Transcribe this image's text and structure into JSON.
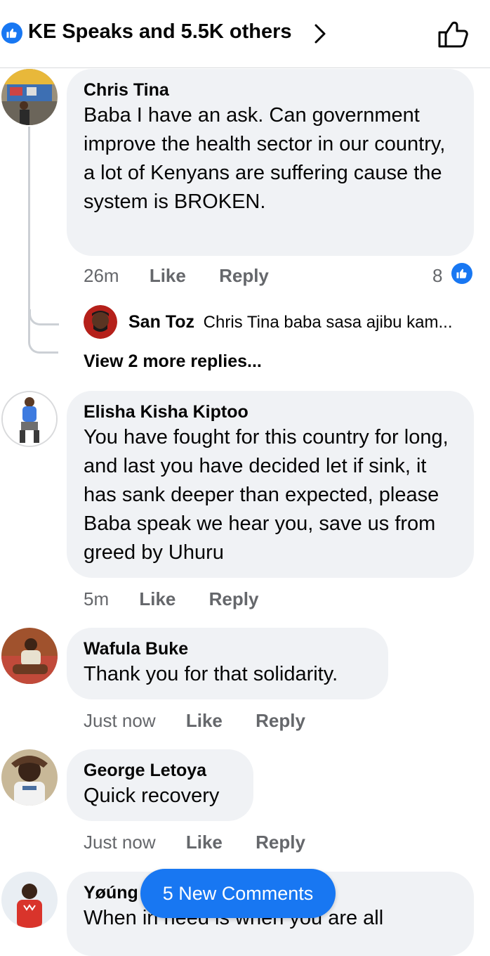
{
  "header": {
    "reactions_text": "KE Speaks and 5.5K others",
    "icons": [
      "like-badge-icon",
      "chevron-right-icon",
      "thumbs-up-outline-icon"
    ]
  },
  "comments": [
    {
      "author": "Chris Tina",
      "text": "Baba I have an ask. Can government improve the health sector in our country, a lot of Kenyans are suffering cause the system is BROKEN.",
      "time": "26m",
      "like_label": "Like",
      "reply_label": "Reply",
      "like_count": "8",
      "reply": {
        "author": "San Toz",
        "text": "Chris Tina baba sasa ajibu kam..."
      },
      "view_more": "View 2 more replies..."
    },
    {
      "author": "Elisha Kisha Kiptoo",
      "text": "You have fought for this country for long, and last you have decided let if sink, it has sank deeper than expected, please Baba speak we hear you, save us from greed by Uhuru",
      "time": "5m",
      "like_label": "Like",
      "reply_label": "Reply"
    },
    {
      "author": "Wafula Buke",
      "text": "Thank you for that solidarity.",
      "time": "Just now",
      "like_label": "Like",
      "reply_label": "Reply"
    },
    {
      "author": "George Letoya",
      "text": "Quick recovery",
      "time": "Just now",
      "like_label": "Like",
      "reply_label": "Reply"
    },
    {
      "author": "Yøúng",
      "text": "When in need is when you are all"
    }
  ],
  "new_comments_label": "5 New Comments",
  "colors": {
    "accent": "#1877f2",
    "bubble": "#f0f2f5",
    "meta": "#65676b"
  }
}
